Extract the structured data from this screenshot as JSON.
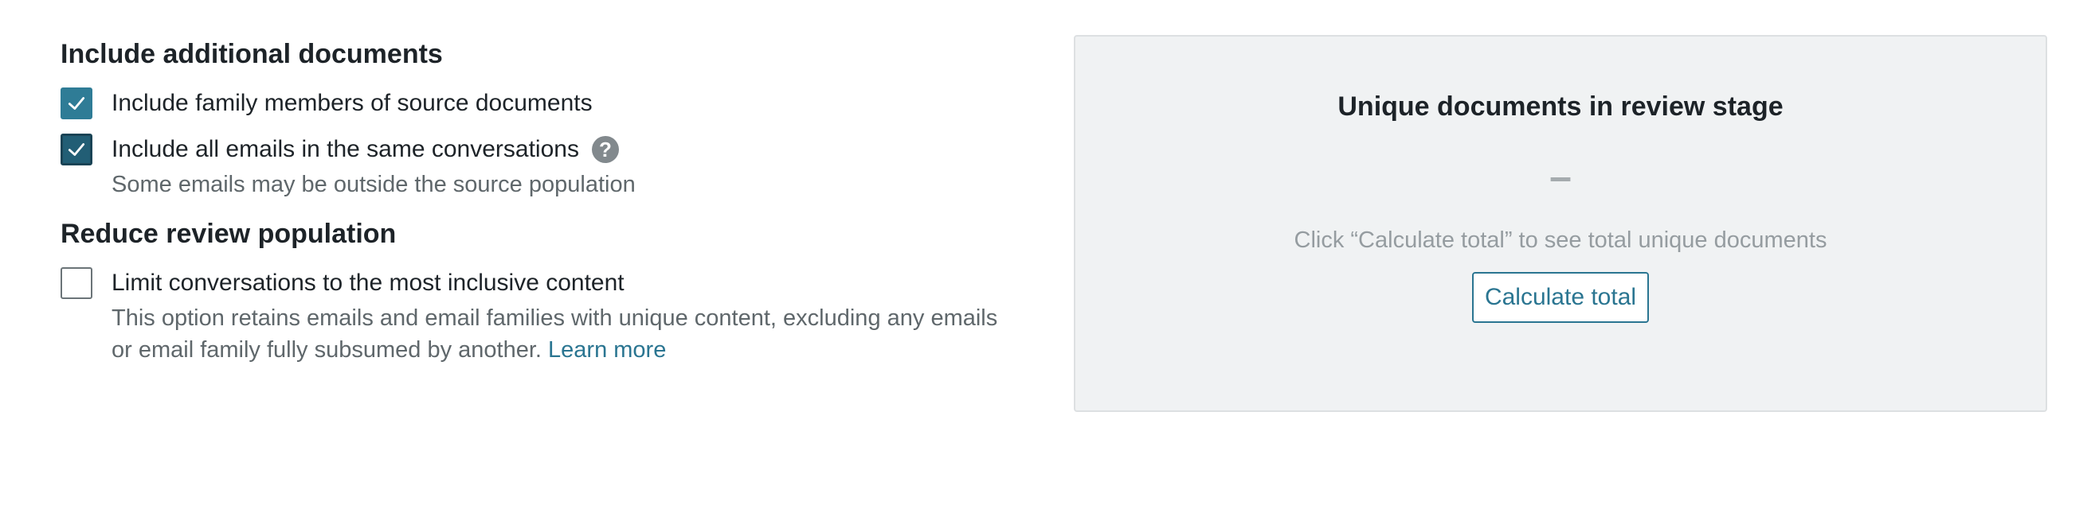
{
  "include_section": {
    "title": "Include additional documents",
    "options": [
      {
        "label": "Include family members of source documents",
        "checked": true
      },
      {
        "label": "Include all emails in the same conversations",
        "checked": true,
        "help_icon": "question-circle-icon",
        "help_glyph": "?",
        "hint": "Some emails may be outside the source population"
      }
    ]
  },
  "reduce_section": {
    "title": "Reduce review population",
    "options": [
      {
        "label": "Limit conversations to the most inclusive content",
        "checked": false,
        "hint_line1": "This option retains emails and email families with unique content, excluding any emails",
        "hint_line2": "or email family fully subsumed by another.",
        "link_label": "Learn more"
      }
    ]
  },
  "summary_panel": {
    "title": "Unique documents in review stage",
    "value": "–",
    "hint": "Click “Calculate total” to see total unique documents",
    "button_label": "Calculate total"
  },
  "colors": {
    "accent": "#2f7c96",
    "link": "#2a7591",
    "panel_background": "#f0f2f3"
  }
}
